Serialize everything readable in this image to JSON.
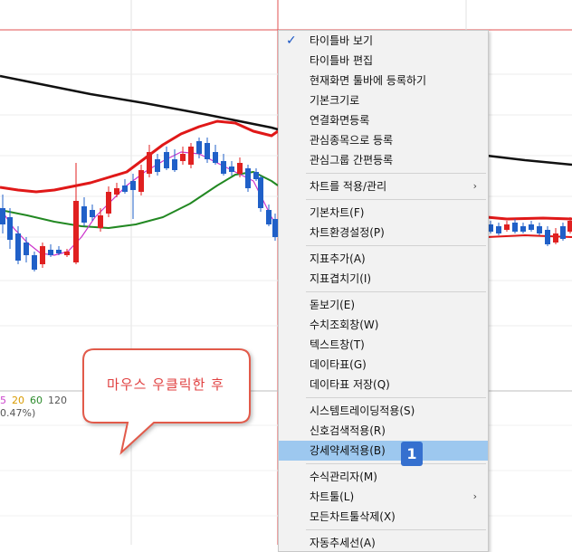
{
  "legend": {
    "periods": [
      {
        "label": "5",
        "color": "#cc44cc"
      },
      {
        "label": "20",
        "color": "#d89a00"
      },
      {
        "label": "60",
        "color": "#2a8a2a"
      },
      {
        "label": "120",
        "color": "#555555"
      }
    ],
    "change_text": "0.47%)"
  },
  "callout": {
    "text": "마우스 우클릭한 후"
  },
  "menu": {
    "groups": [
      [
        {
          "label": "타이틀바 보기",
          "checked": true
        },
        {
          "label": "타이틀바 편집"
        },
        {
          "label": "현재화면 툴바에 등록하기"
        },
        {
          "label": "기본크기로"
        },
        {
          "label": "연결화면등록"
        },
        {
          "label": "관심종목으로 등록"
        },
        {
          "label": "관심그룹 간편등록"
        }
      ],
      [
        {
          "label": "차트를 적용/관리",
          "submenu": true
        }
      ],
      [
        {
          "label": "기본차트(F)"
        },
        {
          "label": "차트환경설정(P)"
        }
      ],
      [
        {
          "label": "지표추가(A)"
        },
        {
          "label": "지표겹치기(I)"
        }
      ],
      [
        {
          "label": "돋보기(E)"
        },
        {
          "label": "수치조회창(W)"
        },
        {
          "label": "텍스트창(T)"
        },
        {
          "label": "데이타표(G)"
        },
        {
          "label": "데이타표 저장(Q)"
        }
      ],
      [
        {
          "label": "시스템트레이딩적용(S)"
        },
        {
          "label": "신호검색적용(R)"
        },
        {
          "label": "강세약세적용(B)",
          "selected": true,
          "badge": "1"
        }
      ],
      [
        {
          "label": "수식관리자(M)"
        },
        {
          "label": "차트툴(L)",
          "submenu": true
        },
        {
          "label": "모든차트툴삭제(X)"
        }
      ],
      [
        {
          "label": "자동추세선(A)"
        }
      ]
    ]
  },
  "chart_data": {
    "type": "candlestick",
    "overlays": [
      "bollinger-upper",
      "bollinger-lower",
      "moving-average-5",
      "moving-average-20",
      "moving-average-120"
    ],
    "colors": {
      "up": "#e02020",
      "down": "#2060c8",
      "bollinger": "#e01818",
      "ma5": "#cc33cc",
      "ma20": "#228822",
      "ma120": "#111111"
    }
  }
}
